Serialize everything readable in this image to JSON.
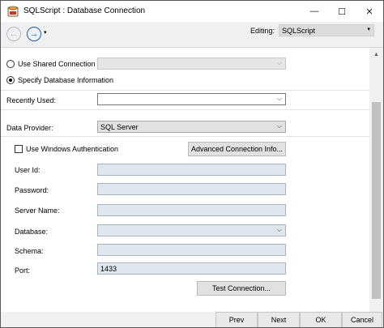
{
  "window": {
    "title": "SQLScript : Database Connection",
    "minimize": "—",
    "maximize": "☐",
    "close": "✕"
  },
  "toolbar": {
    "back": "←",
    "forward": "→",
    "forward_menu": "▾",
    "editing_label": "Editing:",
    "editing_value": "SQLScript",
    "caret": "▾"
  },
  "connection": {
    "shared_label": "Use Shared Connection",
    "shared_value": "",
    "specify_label": "Specify Database Information",
    "selected": "specify"
  },
  "recently_used": {
    "label": "Recently Used:",
    "value": ""
  },
  "data_provider": {
    "label": "Data Provider:",
    "value": "SQL Server"
  },
  "windows_auth": {
    "label": "Use Windows Authentication",
    "checked": false
  },
  "advanced_button": "Advanced Connection Info...",
  "fields": {
    "user_id": {
      "label": "User Id:",
      "value": ""
    },
    "password": {
      "label": "Password:",
      "value": ""
    },
    "server_name": {
      "label": "Server Name:",
      "value": ""
    },
    "database": {
      "label": "Database:",
      "value": ""
    },
    "schema": {
      "label": "Schema:",
      "value": ""
    },
    "port": {
      "label": "Port:",
      "value": "1433"
    }
  },
  "test_button": "Test Connection...",
  "scrollbar": {
    "up": "▲"
  },
  "nav": {
    "prev": "Prev",
    "next": "Next",
    "ok": "OK",
    "cancel": "Cancel"
  },
  "dropdown_caret": "⌵"
}
